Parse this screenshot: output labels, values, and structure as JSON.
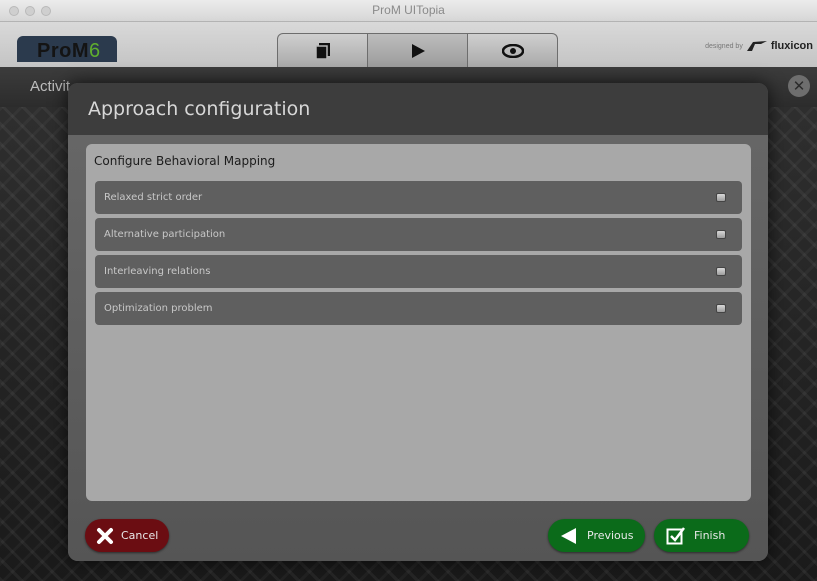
{
  "window": {
    "title": "ProM UITopia"
  },
  "header": {
    "logo_text": "ProM",
    "logo_version": "6",
    "view_tabs": [
      {
        "icon": "workspace-icon"
      },
      {
        "icon": "play-icon"
      },
      {
        "icon": "eye-icon"
      }
    ],
    "brand_prefix": "designed by",
    "brand_name": "fluxicon"
  },
  "activity_bar": {
    "label": "Activit"
  },
  "dialog": {
    "title": "Approach configuration",
    "panel_title": "Configure Behavioral Mapping",
    "options": [
      {
        "label": "Relaxed strict order",
        "checked": false
      },
      {
        "label": "Alternative participation",
        "checked": false
      },
      {
        "label": "Interleaving relations",
        "checked": false
      },
      {
        "label": "Optimization problem",
        "checked": false
      }
    ],
    "buttons": {
      "cancel": "Cancel",
      "previous": "Previous",
      "finish": "Finish"
    }
  },
  "colors": {
    "cancel_bg": "#6b0d12",
    "confirm_bg": "#0b6b1a",
    "logo_version": "#5fae2e"
  }
}
